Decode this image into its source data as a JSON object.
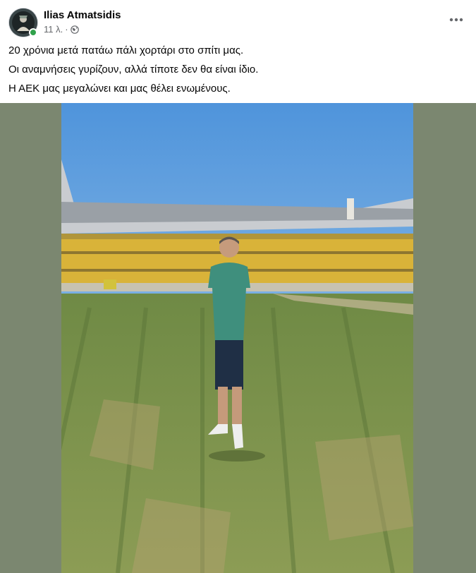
{
  "post": {
    "author": "Ilias Atmatsidis",
    "time": "11 λ.",
    "separator": "·",
    "privacy_icon": "globe-icon",
    "more_icon": "more-options-icon",
    "lines": [
      "20 χρόνια μετά πατάω πάλι χορτάρι στο σπίτι μας.",
      "Οι αναμνήσεις γυρίζουν, αλλά τίποτε δεν θα είναι ίδιο.",
      "Η ΑΕΚ μας μεγαλώνει και μας θέλει ενωμένους."
    ]
  },
  "colors": {
    "media_background": "#7b8770",
    "online_indicator": "#31a24c",
    "secondary_text": "#65676b"
  }
}
